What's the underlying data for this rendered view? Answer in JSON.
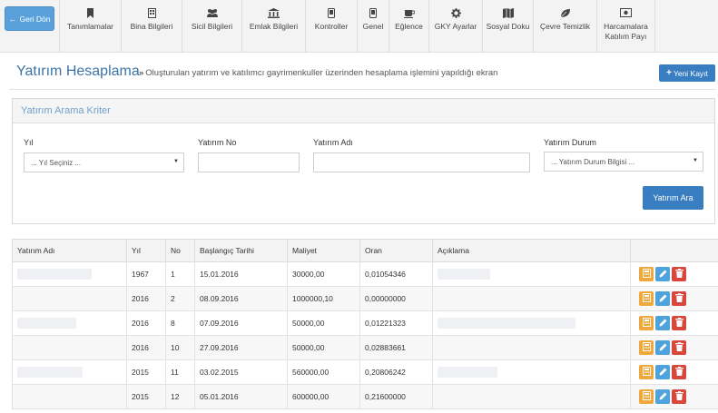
{
  "nav": {
    "back_label": "Geri Dön",
    "items": [
      {
        "label": "Tanımlamalar",
        "icon": "bookmark-icon",
        "w": 69
      },
      {
        "label": "Bina Bilgileri",
        "icon": "building-icon",
        "w": 67
      },
      {
        "label": "Sicil Bilgileri",
        "icon": "users-icon",
        "w": 66
      },
      {
        "label": "Emlak Bilgileri",
        "icon": "bank-icon",
        "w": 70
      },
      {
        "label": "Kontroller",
        "icon": "phone-icon",
        "w": 57
      },
      {
        "label": "Genel",
        "icon": "phone-icon",
        "w": 35
      },
      {
        "label": "Eğlence",
        "icon": "coffee-icon",
        "w": 44
      },
      {
        "label": "GKY Ayarlar",
        "icon": "gear-icon",
        "w": 59
      },
      {
        "label": "Sosyal Doku",
        "icon": "map-icon",
        "w": 56
      },
      {
        "label": "Çevre Temizlik",
        "icon": "leaf-icon",
        "w": 70
      },
      {
        "label": "Harcamalara\nKatılım Payı",
        "icon": "money-icon",
        "w": 64
      }
    ]
  },
  "header": {
    "title": "Yatırım Hesaplama",
    "desc": "Oluşturulan yatırım ve katılımcı gayrimenkuller üzerinden hesaplama işlemini yapıldığı ekran",
    "new_label": "Yeni Kayıt"
  },
  "search": {
    "title": "Yatırım Arama Kriter",
    "year_label": "Yıl",
    "year_value": "... Yıl Seçiniz ...",
    "no_label": "Yatırım No",
    "name_label": "Yatırım Adı",
    "status_label": "Yatırım Durum",
    "status_value": "... Yatırım Durum Bilgisi ...",
    "button": "Yatırım Ara"
  },
  "table": {
    "headers": [
      "Yatırım Adı",
      "Yıl",
      "No",
      "Başlangıç Tarihi",
      "Maliyet",
      "Oran",
      "Açıklama",
      ""
    ],
    "rows": [
      {
        "name_w": 82,
        "year": "1967",
        "no": "1",
        "date": "15.01.2016",
        "cost": "30000,00",
        "rate": "0,01054346",
        "desc_w": 58
      },
      {
        "name_w": 0,
        "year": "2016",
        "no": "2",
        "date": "08.09.2016",
        "cost": "1000000,10",
        "rate": "0,00000000",
        "desc_w": 0
      },
      {
        "name_w": 65,
        "year": "2016",
        "no": "8",
        "date": "07.09.2016",
        "cost": "50000,00",
        "rate": "0,01221323",
        "desc_w": 152
      },
      {
        "name_w": 0,
        "year": "2016",
        "no": "10",
        "date": "27.09.2016",
        "cost": "50000,00",
        "rate": "0,02883661",
        "desc_w": 0
      },
      {
        "name_w": 72,
        "year": "2015",
        "no": "11",
        "date": "03.02.2015",
        "cost": "560000,00",
        "rate": "0,20806242",
        "desc_w": 66
      },
      {
        "name_w": 0,
        "year": "2015",
        "no": "12",
        "date": "05.01.2016",
        "cost": "600000,00",
        "rate": "0,21600000",
        "desc_w": 0
      }
    ]
  }
}
